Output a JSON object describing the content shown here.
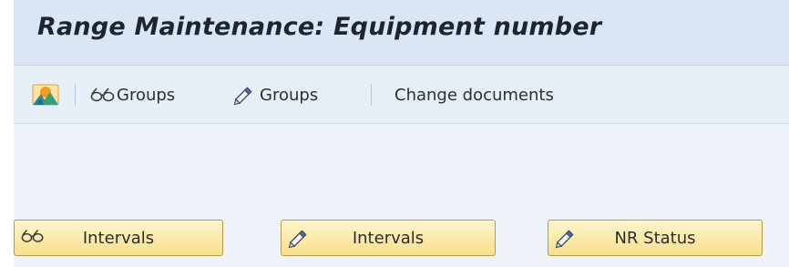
{
  "window": {
    "title": "Range Maintenance: Equipment number"
  },
  "toolbar": {
    "items": [
      {
        "icon": "landscape-icon",
        "label": ""
      },
      {
        "icon": "glasses-icon",
        "label": "Groups"
      },
      {
        "icon": "pencil-icon",
        "label": "Groups"
      },
      {
        "icon": "",
        "label": "Change documents"
      }
    ]
  },
  "buttons": [
    {
      "icon": "glasses-icon",
      "label": "Intervals"
    },
    {
      "icon": "pencil-icon",
      "label": "Intervals"
    },
    {
      "icon": "pencil-icon",
      "label": "NR Status"
    }
  ],
  "colors": {
    "title_bar": "#dbe6f4",
    "toolbar": "#e6eef8",
    "background": "#eef3fa",
    "button_top": "#fff6cf",
    "button_bottom": "#f7df8c",
    "button_border": "#b89a4a"
  }
}
